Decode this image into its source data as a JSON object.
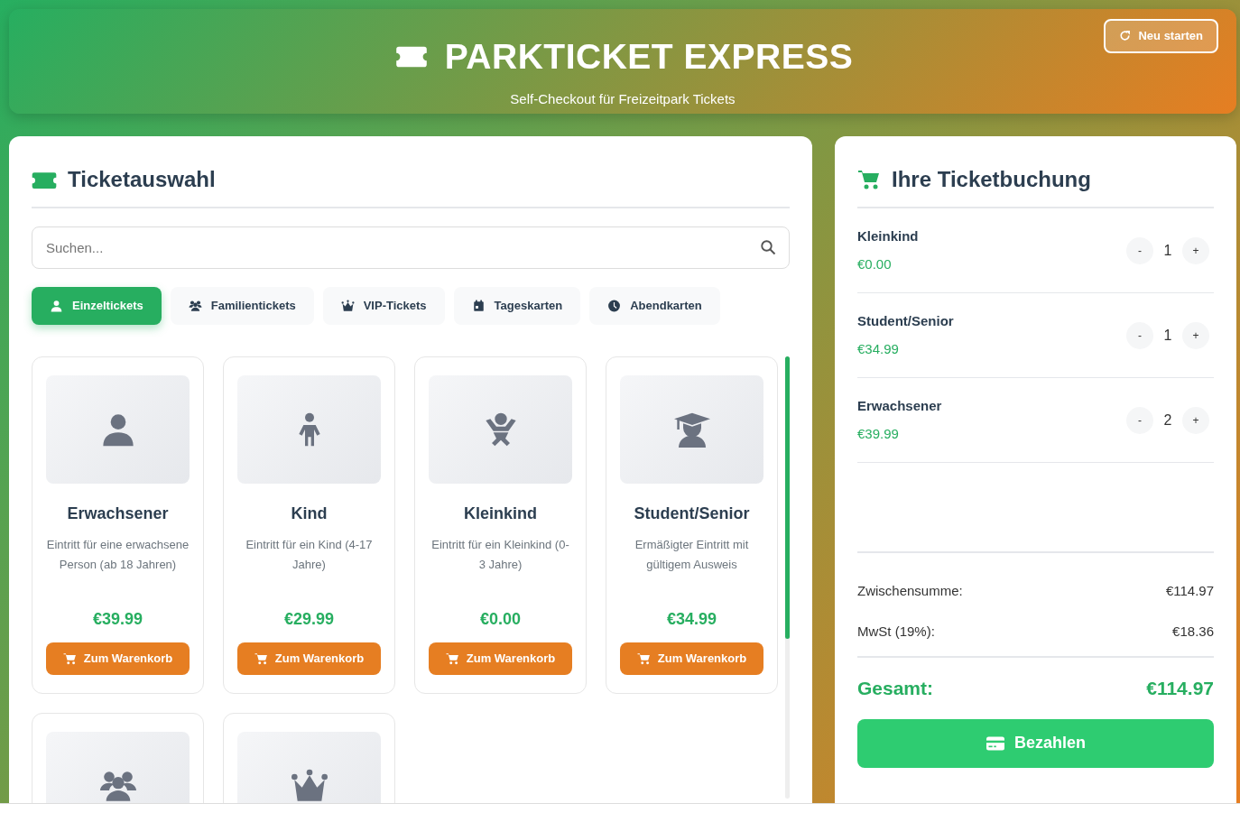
{
  "header": {
    "title": "PARKTICKET EXPRESS",
    "subtitle": "Self-Checkout für Freizeitpark Tickets",
    "restart_button": "Neu starten"
  },
  "ticket_panel": {
    "title": "Ticketauswahl",
    "search": {
      "placeholder": "Suchen..."
    },
    "tabs": [
      {
        "label": "Einzeltickets",
        "selected": true
      },
      {
        "label": "Familientickets",
        "selected": false
      },
      {
        "label": "VIP-Tickets",
        "selected": false
      },
      {
        "label": "Tageskarten",
        "selected": false
      },
      {
        "label": "Abendkarten",
        "selected": false
      }
    ],
    "tickets": [
      {
        "name": "Erwachsener",
        "description": "Eintritt für eine erwachsene Person (ab 18 Jahren)",
        "price": "€39.99",
        "button": "Zum Warenkorb"
      },
      {
        "name": "Kind",
        "description": "Eintritt für ein Kind (4-17 Jahre)",
        "price": "€29.99",
        "button": "Zum Warenkorb"
      },
      {
        "name": "Kleinkind",
        "description": "Eintritt für ein Kleinkind (0-3 Jahre)",
        "price": "€0.00",
        "button": "Zum Warenkorb"
      },
      {
        "name": "Student/Senior",
        "description": "Ermäßigter Eintritt mit gültigem Ausweis",
        "price": "€34.99",
        "button": "Zum Warenkorb"
      },
      {
        "kind": "picture"
      },
      {
        "kind": "picture"
      }
    ]
  },
  "cart_panel": {
    "title": "Ihre Ticketbuchung",
    "items": [
      {
        "name": "Kleinkind",
        "price": "€0.00",
        "quantity": "1",
        "minus": "-",
        "plus": "+"
      },
      {
        "name": "Student/Senior",
        "price": "€34.99",
        "quantity": "1",
        "minus": "-",
        "plus": "+"
      },
      {
        "name": "Erwachsener",
        "price": "€39.99",
        "quantity": "2",
        "minus": "-",
        "plus": "+"
      }
    ],
    "summary": [
      {
        "label": "Zwischensumme:",
        "value": "€114.97"
      },
      {
        "label": "MwSt (19%):",
        "value": "€18.36"
      }
    ],
    "total": {
      "label": "Gesamt:",
      "value": "€114.97"
    },
    "pay_button": "Bezahlen"
  }
}
